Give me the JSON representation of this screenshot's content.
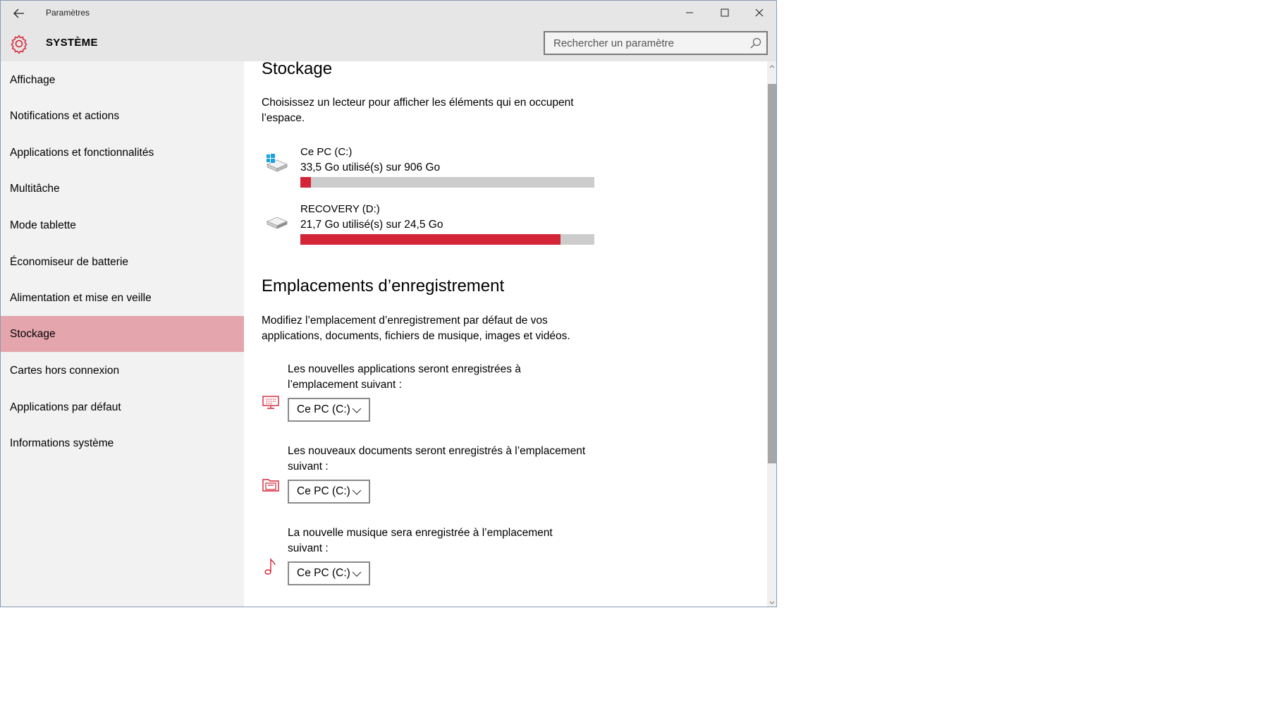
{
  "window": {
    "title": "Paramètres",
    "back_icon": "back-arrow-icon",
    "minimize_icon": "minimize-icon",
    "maximize_icon": "maximize-icon",
    "close_icon": "close-icon"
  },
  "header": {
    "icon": "gear-icon",
    "title": "SYSTÈME",
    "search_placeholder": "Rechercher un paramètre",
    "search_value": ""
  },
  "sidebar": {
    "selected_color": "#e4a5ad",
    "items": [
      {
        "label": "Affichage",
        "selected": false
      },
      {
        "label": "Notifications et actions",
        "selected": false
      },
      {
        "label": "Applications et fonctionnalités",
        "selected": false
      },
      {
        "label": "Multitâche",
        "selected": false
      },
      {
        "label": "Mode tablette",
        "selected": false
      },
      {
        "label": "Économiseur de batterie",
        "selected": false
      },
      {
        "label": "Alimentation et mise en veille",
        "selected": false
      },
      {
        "label": "Stockage",
        "selected": true
      },
      {
        "label": "Cartes hors connexion",
        "selected": false
      },
      {
        "label": "Applications par défaut",
        "selected": false
      },
      {
        "label": "Informations système",
        "selected": false
      }
    ]
  },
  "storage": {
    "heading": "Stockage",
    "description": "Choisissez un lecteur pour afficher les éléments qui en occupent l’espace.",
    "accent_color": "#d42437",
    "drives": [
      {
        "name": "Ce PC (C:)",
        "usage": "33,5 Go utilisé(s) sur 906 Go",
        "used_fraction": 0.037,
        "icon": "windows-drive-icon"
      },
      {
        "name": "RECOVERY (D:)",
        "usage": "21,7 Go utilisé(s) sur 24,5 Go",
        "used_fraction": 0.886,
        "icon": "drive-icon"
      }
    ]
  },
  "save_locations": {
    "heading": "Emplacements d’enregistrement",
    "description": "Modifiez l’emplacement d’enregistrement par défaut de vos applications, documents, fichiers de musique, images et vidéos.",
    "items": [
      {
        "label": "Les nouvelles applications seront enregistrées à l’emplacement suivant :",
        "value": "Ce PC (C:)",
        "icon": "apps-monitor-icon"
      },
      {
        "label": "Les nouveaux documents seront enregistrés à l’emplacement suivant :",
        "value": "Ce PC (C:)",
        "icon": "documents-icon"
      },
      {
        "label": "La nouvelle musique sera enregistrée à l’emplacement suivant :",
        "value": "Ce PC (C:)",
        "icon": "music-note-icon"
      }
    ]
  }
}
